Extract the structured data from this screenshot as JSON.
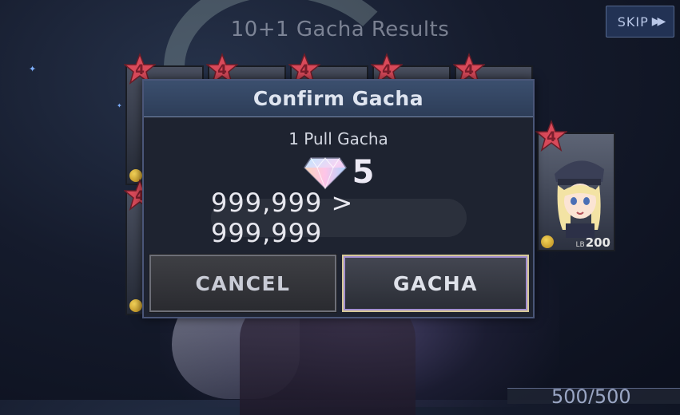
{
  "results_title": "10+1 Gacha Results",
  "skip": {
    "label": "SKIP",
    "icon": "fast-forward-icon"
  },
  "cards": {
    "rarity": "4",
    "lb_prefix": "LB",
    "lb_value": "200"
  },
  "dialog": {
    "title": "Confirm Gacha",
    "pull_label": "1 Pull Gacha",
    "cost_icon": "diamond-gem-icon",
    "cost": "5",
    "balance": "999,999 > 999,999",
    "cancel_label": "CANCEL",
    "gacha_label": "GACHA"
  },
  "bottom_counter": "500/500",
  "colors": {
    "rarity_star": "#d94a5a",
    "dialog_header": "#3b4f6e",
    "gacha_border": "#d7c997",
    "coin": "#e0b83a"
  }
}
